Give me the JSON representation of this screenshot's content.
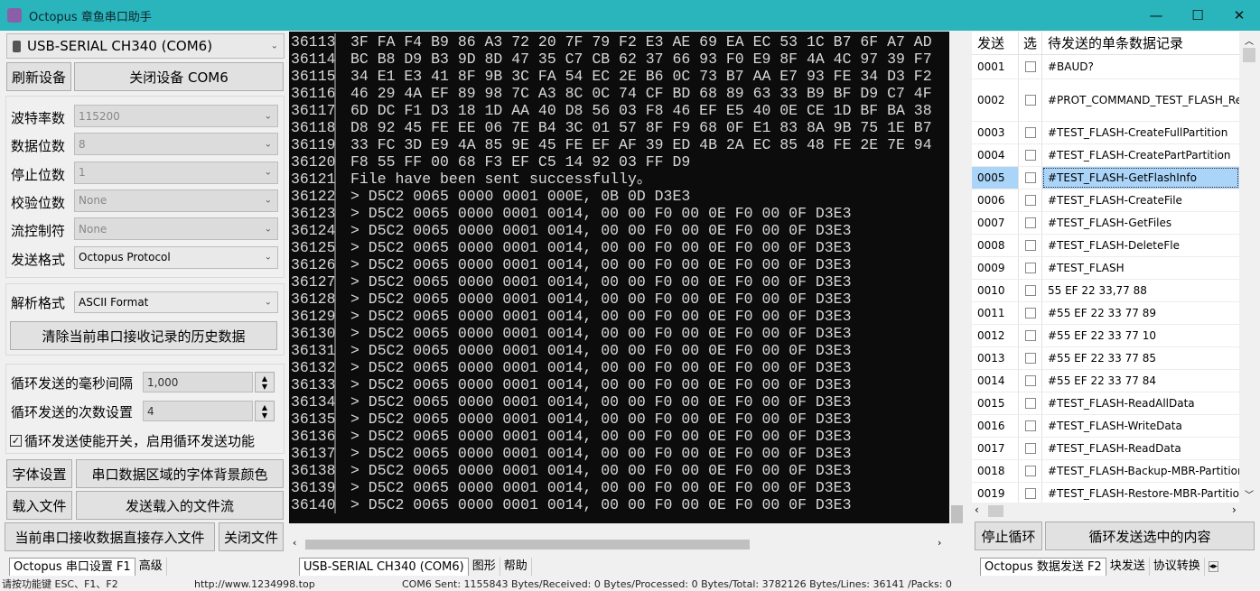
{
  "window": {
    "title": "Octopus 章鱼串口助手",
    "minimize": "—",
    "maximize": "☐",
    "close": "✕"
  },
  "left": {
    "device": "USB-SERIAL CH340 (COM6)",
    "refresh": "刷新设备",
    "close_device": "关闭设备 COM6",
    "settings": [
      {
        "label": "波特率数",
        "value": "115200",
        "disabled": true
      },
      {
        "label": "数据位数",
        "value": "8",
        "disabled": true
      },
      {
        "label": "停止位数",
        "value": "1",
        "disabled": true
      },
      {
        "label": "校验位数",
        "value": "None",
        "disabled": true
      },
      {
        "label": "流控制符",
        "value": "None",
        "disabled": true
      },
      {
        "label": "发送格式",
        "value": "Octopus Protocol",
        "disabled": false
      }
    ],
    "parse_label": "解析格式",
    "parse_value": "ASCII Format",
    "clear_history": "清除当前串口接收记录的历史数据",
    "interval_label": "循环发送的毫秒间隔",
    "interval_value": "1,000",
    "count_label": "循环发送的次数设置",
    "count_value": "4",
    "loop_enable": "循环发送使能开关，启用循环发送功能",
    "loop_checked": true,
    "font_settings": "字体设置",
    "bg_color": "串口数据区域的字体背景颜色",
    "load_file": "载入文件",
    "send_file": "发送载入的文件流",
    "save_to_file": "当前串口接收数据直接存入文件",
    "close_file": "关闭文件"
  },
  "terminal": {
    "lines": [
      [
        "36113",
        "3F FA F4 B9 86 A3 72 20 7F 79 F2 E3 AE 69 EA EC 53 1C B7 6F A7 AD"
      ],
      [
        "36114",
        "BC B8 D9 B3 9D 8D 47 35 C7 CB 62 37 66 93 F0 E9 8F 4A 4C 97 39 F7"
      ],
      [
        "36115",
        "34 E1 E3 41 8F 9B 3C FA 54 EC 2E B6 0C 73 B7 AA E7 93 FE 34 D3 F2"
      ],
      [
        "36116",
        "46 29 4A EF 89 98 7C A3 8C 0C 74 CF BD 68 89 63 33 B9 BF D9 C7 4F"
      ],
      [
        "36117",
        "6D DC F1 D3 18 1D AA 40 D8 56 03 F8 46 EF E5 40 0E CE 1D BF BA 38"
      ],
      [
        "36118",
        "D8 92 45 FE EE 06 7E B4 3C 01 57 8F F9 68 0F E1 83 8A 9B 75 1E B7"
      ],
      [
        "36119",
        "33 FC 3D E9 4A 85 9E 45 FE EF AF 39 ED 4B 2A EC 85 48 FE 2E 7E 94"
      ],
      [
        "36120",
        "F8 55 FF 00 68 F3 EF C5 14 92 03 FF D9"
      ],
      [
        "36121",
        "File have been sent successfully。"
      ],
      [
        "36122",
        "> D5C2 0065 0000 0001 000E, 0B 0D D3E3"
      ],
      [
        "36123",
        "> D5C2 0065 0000 0001 0014, 00 00 F0 00 0E F0 00 0F D3E3"
      ],
      [
        "36124",
        "> D5C2 0065 0000 0001 0014, 00 00 F0 00 0E F0 00 0F D3E3"
      ],
      [
        "36125",
        "> D5C2 0065 0000 0001 0014, 00 00 F0 00 0E F0 00 0F D3E3"
      ],
      [
        "36126",
        "> D5C2 0065 0000 0001 0014, 00 00 F0 00 0E F0 00 0F D3E3"
      ],
      [
        "36127",
        "> D5C2 0065 0000 0001 0014, 00 00 F0 00 0E F0 00 0F D3E3"
      ],
      [
        "36128",
        "> D5C2 0065 0000 0001 0014, 00 00 F0 00 0E F0 00 0F D3E3"
      ],
      [
        "36129",
        "> D5C2 0065 0000 0001 0014, 00 00 F0 00 0E F0 00 0F D3E3"
      ],
      [
        "36130",
        "> D5C2 0065 0000 0001 0014, 00 00 F0 00 0E F0 00 0F D3E3"
      ],
      [
        "36131",
        "> D5C2 0065 0000 0001 0014, 00 00 F0 00 0E F0 00 0F D3E3"
      ],
      [
        "36132",
        "> D5C2 0065 0000 0001 0014, 00 00 F0 00 0E F0 00 0F D3E3"
      ],
      [
        "36133",
        "> D5C2 0065 0000 0001 0014, 00 00 F0 00 0E F0 00 0F D3E3"
      ],
      [
        "36134",
        "> D5C2 0065 0000 0001 0014, 00 00 F0 00 0E F0 00 0F D3E3"
      ],
      [
        "36135",
        "> D5C2 0065 0000 0001 0014, 00 00 F0 00 0E F0 00 0F D3E3"
      ],
      [
        "36136",
        "> D5C2 0065 0000 0001 0014, 00 00 F0 00 0E F0 00 0F D3E3"
      ],
      [
        "36137",
        "> D5C2 0065 0000 0001 0014, 00 00 F0 00 0E F0 00 0F D3E3"
      ],
      [
        "36138",
        "> D5C2 0065 0000 0001 0014, 00 00 F0 00 0E F0 00 0F D3E3"
      ],
      [
        "36139",
        "> D5C2 0065 0000 0001 0014, 00 00 F0 00 0E F0 00 0F D3E3"
      ],
      [
        "36140",
        "> D5C2 0065 0000 0001 0014, 00 00 F0 00 0E F0 00 0F D3E3"
      ]
    ]
  },
  "right": {
    "headers": [
      "发送",
      "选",
      "待发送的单条数据记录"
    ],
    "selected_row": "0005",
    "rows": [
      [
        "0001",
        "#BAUD?"
      ],
      [
        "0002",
        "#PROT_COMMAND_TEST_FLASH_ReadAll"
      ],
      [
        "0003",
        "#TEST_FLASH-CreateFullPartition"
      ],
      [
        "0004",
        "#TEST_FLASH-CreatePartPartition"
      ],
      [
        "0005",
        "#TEST_FLASH-GetFlashInfo"
      ],
      [
        "0006",
        "#TEST_FLASH-CreateFile"
      ],
      [
        "0007",
        "#TEST_FLASH-GetFiles"
      ],
      [
        "0008",
        "#TEST_FLASH-DeleteFle"
      ],
      [
        "0009",
        "#TEST_FLASH"
      ],
      [
        "0010",
        "55 EF 22 33,77 88"
      ],
      [
        "0011",
        "#55 EF 22 33 77 89"
      ],
      [
        "0012",
        "#55 EF 22 33 77 10"
      ],
      [
        "0013",
        "#55 EF 22 33 77 85"
      ],
      [
        "0014",
        "#55 EF 22 33 77 84"
      ],
      [
        "0015",
        "#TEST_FLASH-ReadAllData"
      ],
      [
        "0016",
        "#TEST_FLASH-WriteData"
      ],
      [
        "0017",
        "#TEST_FLASH-ReadData"
      ],
      [
        "0018",
        "#TEST_FLASH-Backup-MBR-Partition"
      ],
      [
        "0019",
        "#TEST_FLASH-Restore-MBR-Partition"
      ]
    ],
    "stop_loop": "停止循环",
    "loop_send": "循环发送选中的内容"
  },
  "tabs": {
    "left": [
      "Octopus 串口设置 F1",
      "高级"
    ],
    "middle": [
      "USB-SERIAL CH340 (COM6)",
      "图形",
      "帮助"
    ],
    "right": [
      "Octopus 数据发送 F2",
      "块发送",
      "协议转换"
    ]
  },
  "status": {
    "hint": "请按功能键 ESC、F1、F2",
    "url": "http://www.1234998.top",
    "stats": "COM6 Sent: 1155843 Bytes/Received: 0 Bytes/Processed: 0 Bytes/Total: 3782126 Bytes/Lines: 36141 /Packs: 0"
  }
}
